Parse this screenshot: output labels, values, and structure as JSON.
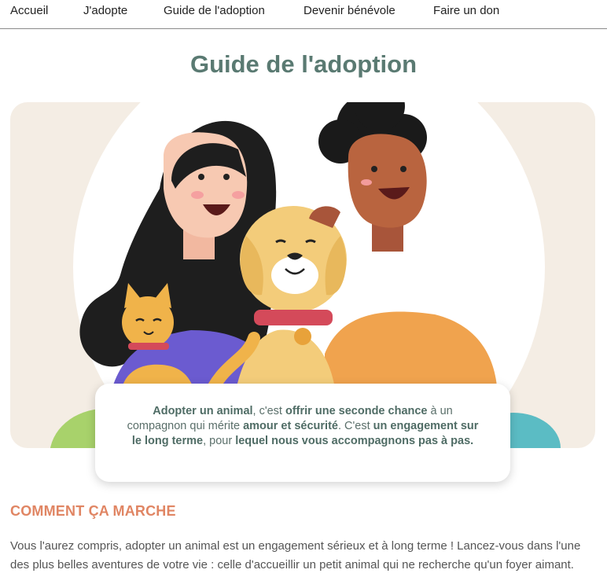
{
  "nav": {
    "items": [
      {
        "label": "Accueil"
      },
      {
        "label": "J'adopte"
      },
      {
        "label": "Guide de l'adoption"
      },
      {
        "label": "Devenir bénévole"
      },
      {
        "label": "Faire un don"
      }
    ]
  },
  "page": {
    "title": "Guide de l'adoption"
  },
  "callout": {
    "s1": "Adopter un animal",
    "t1": ", c'est ",
    "s2": "offrir une seconde chance",
    "t2": " à un compagnon qui mérite ",
    "s3": "amour et sécurité",
    "t3": ". C'est ",
    "s4": "un engagement sur le long terme",
    "t4": ", pour ",
    "s5": "lequel nous vous accompagnons pas à pas."
  },
  "section": {
    "title": "COMMENT ÇA MARCHE",
    "paragraph": "Vous l'aurez compris, adopter un animal est un engagement sérieux et à long terme ! Lancez-vous dans l'une des plus belles aventures de votre vie : celle d'accueillir un petit animal qui ne recherche qu'un foyer aimant."
  },
  "colors": {
    "title": "#5a7a72",
    "section_title": "#e08563",
    "hero_bg": "#f4ede4"
  }
}
